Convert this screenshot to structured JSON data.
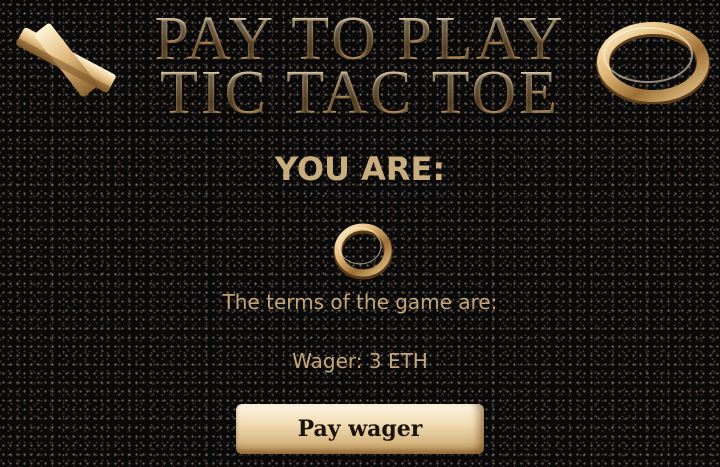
{
  "title": {
    "line1": "PAY TO PLAY",
    "line2": "TIC TAC TOE"
  },
  "decorations": {
    "left_icon": "gold-x-icon",
    "right_icon": "gold-o-icon"
  },
  "player": {
    "heading": "YOU ARE:",
    "symbol_icon": "gold-o-icon"
  },
  "terms": {
    "heading": "The terms of the game are:",
    "wager": "Wager: 3 ETH"
  },
  "actions": {
    "pay_label": "Pay wager"
  },
  "colors": {
    "gold": "#d9bd8f",
    "text_gold": "#c4a678",
    "background": "#0b0a0a"
  }
}
